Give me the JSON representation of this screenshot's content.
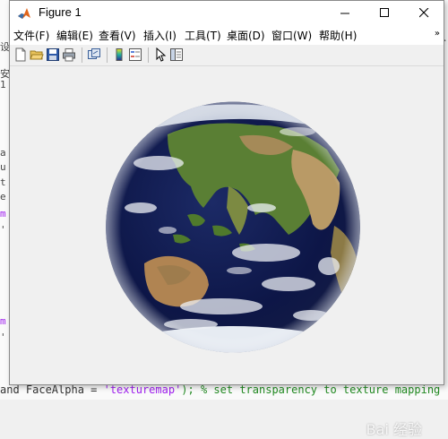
{
  "window": {
    "title": "Figure 1"
  },
  "menu": {
    "items": [
      "文件(F)",
      "编辑(E)",
      "查看(V)",
      "插入(I)",
      "工具(T)",
      "桌面(D)",
      "窗口(W)",
      "帮助(H)"
    ],
    "overflow": "»"
  },
  "toolbar": {
    "buttons": [
      "new-figure-icon",
      "open-file-icon",
      "save-icon",
      "print-icon",
      "link-plot-icon",
      "colorbar-icon",
      "legend-icon",
      "edit-plot-arrow-icon",
      "property-inspector-icon"
    ]
  },
  "background": {
    "left_fragments": [
      "设",
      "安",
      "1",
      "a",
      "u",
      "t",
      "e",
      "m",
      "'",
      "m",
      "'"
    ],
    "bottom_line_prefix": "and FaceAlpha = ",
    "bottom_line_string": "'texturemap'",
    "bottom_line_comment": ");  % set transparency to texture mapping"
  },
  "watermark": "Bai 经验",
  "colors": {
    "ocean": "#101a4e",
    "land_green": "#4f7a2c",
    "desert": "#b99a66",
    "cloud": "#e9ecf2",
    "figure_bg": "#f0f0f0"
  }
}
